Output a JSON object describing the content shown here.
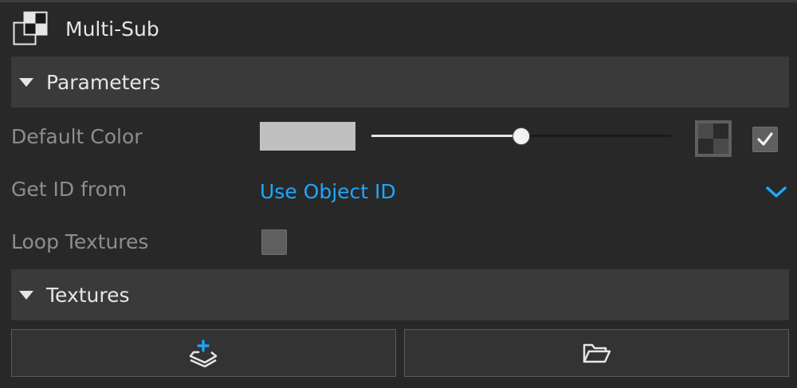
{
  "header": {
    "title": "Multi-Sub",
    "icon": "multi-sub-material-icon"
  },
  "sections": {
    "parameters": {
      "label": "Parameters",
      "expanded": true
    },
    "textures": {
      "label": "Textures",
      "expanded": true
    }
  },
  "properties": {
    "default_color": {
      "label": "Default Color",
      "swatch_color": "#c0c0c0",
      "slider_value": 0.5,
      "texture_icon": "checker-texture-icon",
      "enabled": true
    },
    "get_id_from": {
      "label": "Get ID from",
      "value": "Use Object ID",
      "accent_color": "#1ea7ff"
    },
    "loop_textures": {
      "label": "Loop Textures",
      "checked": false
    }
  },
  "textures_actions": {
    "add_icon": "add-layer-icon",
    "open_icon": "folder-open-icon"
  }
}
